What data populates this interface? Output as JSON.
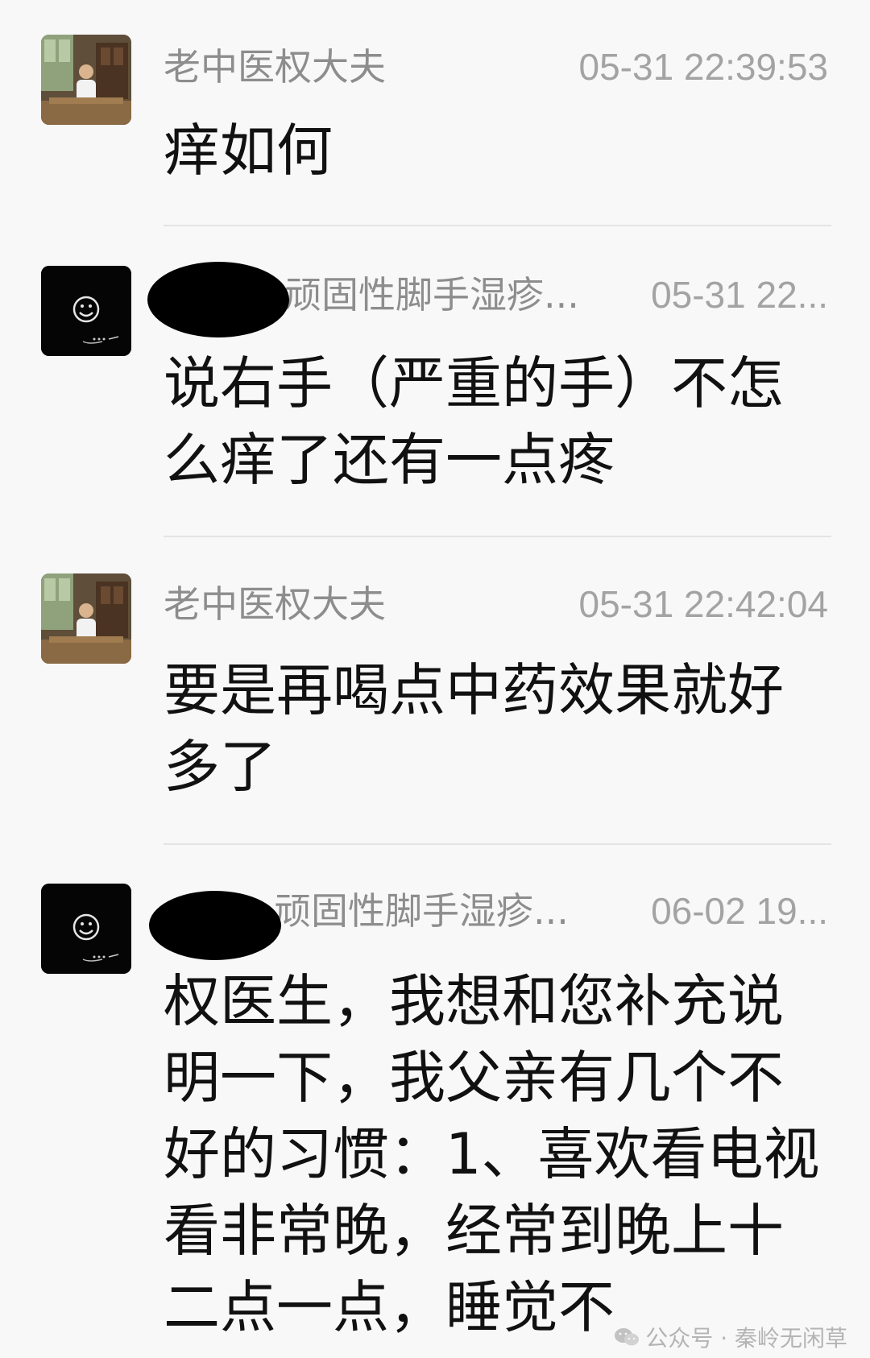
{
  "messages": [
    {
      "sender": "老中医权大夫",
      "time": "05-31 22:39:53",
      "text": "痒如何",
      "avatar_icon": "doctor-photo-avatar"
    },
    {
      "sender": "顽固性脚手湿疹...",
      "time": "05-31 22...",
      "text": "说右手（严重的手）不怎么痒了还有一点疼",
      "avatar_icon": "smiley-avatar"
    },
    {
      "sender": "老中医权大夫",
      "time": "05-31 22:42:04",
      "text": "要是再喝点中药效果就好多了",
      "avatar_icon": "doctor-photo-avatar"
    },
    {
      "sender": "顽固性脚手湿疹...",
      "time": "06-02 19...",
      "text": "权医生，我想和您补充说明一下，我父亲有几个不好的习惯：1、喜欢看电视看非常晚，经常到晚上十二点一点，睡觉不",
      "avatar_icon": "smiley-avatar"
    }
  ],
  "watermark": {
    "text": "公众号 · 秦岭无闲草",
    "icon": "wechat-icon"
  }
}
